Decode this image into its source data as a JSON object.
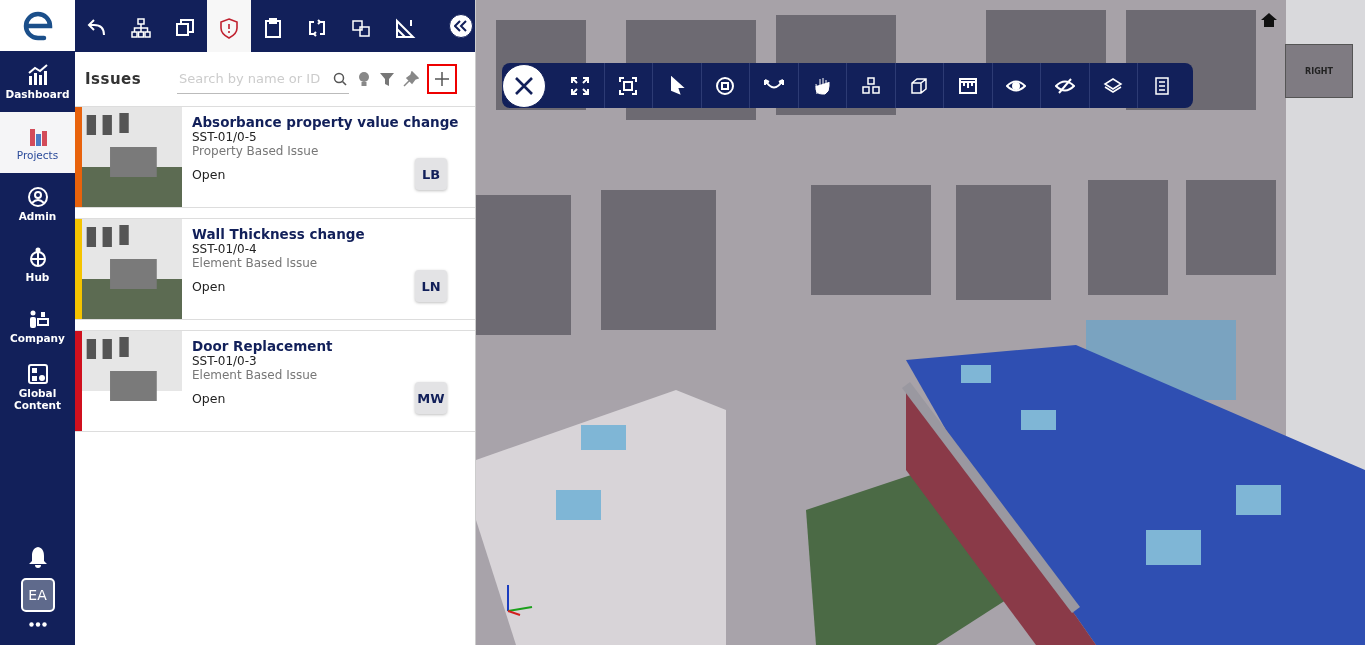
{
  "nav": {
    "items": [
      {
        "label": "Dashboard",
        "selected": false
      },
      {
        "label": "Projects",
        "selected": true
      },
      {
        "label": "Admin",
        "selected": false
      },
      {
        "label": "Hub",
        "selected": false
      },
      {
        "label": "Company",
        "selected": false
      },
      {
        "label": "Global Content",
        "selected": false
      }
    ],
    "user_initials": "EA"
  },
  "tabs": [
    {
      "selected": false
    },
    {
      "selected": false
    },
    {
      "selected": false
    },
    {
      "selected": true
    },
    {
      "selected": false
    },
    {
      "selected": false
    },
    {
      "selected": false
    },
    {
      "selected": false
    }
  ],
  "issues_panel": {
    "title": "Issues",
    "search": {
      "placeholder": "Search by name or ID"
    },
    "add_highlighted": true,
    "issues": [
      {
        "title": "Absorbance property value change",
        "id": "SST-01/0-5",
        "type": "Property Based Issue",
        "status": "Open",
        "assignee": "LB",
        "color": "#e8620c"
      },
      {
        "title": "Wall Thickness change",
        "id": "SST-01/0-4",
        "type": "Element Based Issue",
        "status": "Open",
        "assignee": "LN",
        "color": "#f5c400"
      },
      {
        "title": "Door Replacement",
        "id": "SST-01/0-3",
        "type": "Element Based Issue",
        "status": "Open",
        "assignee": "MW",
        "color": "#d0101e"
      }
    ]
  },
  "viewer": {
    "view_cube_label": "RIGHT"
  }
}
